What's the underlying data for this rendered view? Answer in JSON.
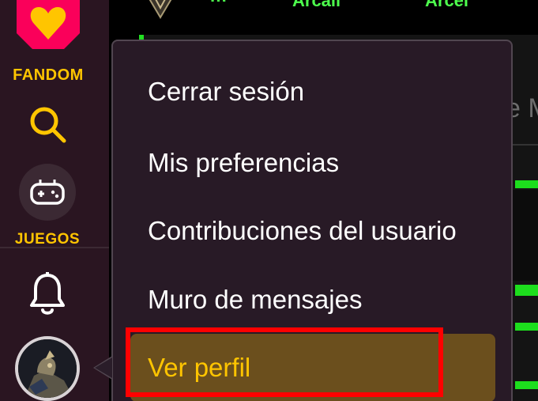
{
  "nav": {
    "logo_word": "FANDOM",
    "games_word": "JUEGOS",
    "icons": [
      "fandom-heart-icon",
      "search-icon",
      "gamepad-icon",
      "bell-icon",
      "avatar"
    ]
  },
  "page": {
    "top_tabs": [
      "···",
      "Arcail",
      "Arcel"
    ],
    "side_title": "e M"
  },
  "menu": {
    "items": [
      {
        "label": "Cerrar sesión"
      },
      {
        "label": "Mis preferencias"
      },
      {
        "label": "Contribuciones del usuario"
      },
      {
        "label": "Muro de mensajes"
      },
      {
        "label": "Ver perfil"
      }
    ],
    "highlighted_index": 4
  },
  "colors": {
    "brand_yellow": "#ffc500",
    "brand_pink": "#fa005a",
    "nav_bg": "#2a1521",
    "menu_bg": "#281a26",
    "highlight_bg": "#6b4f1d",
    "annotation_red": "#ff0000",
    "accent_green": "#1dde1d"
  }
}
